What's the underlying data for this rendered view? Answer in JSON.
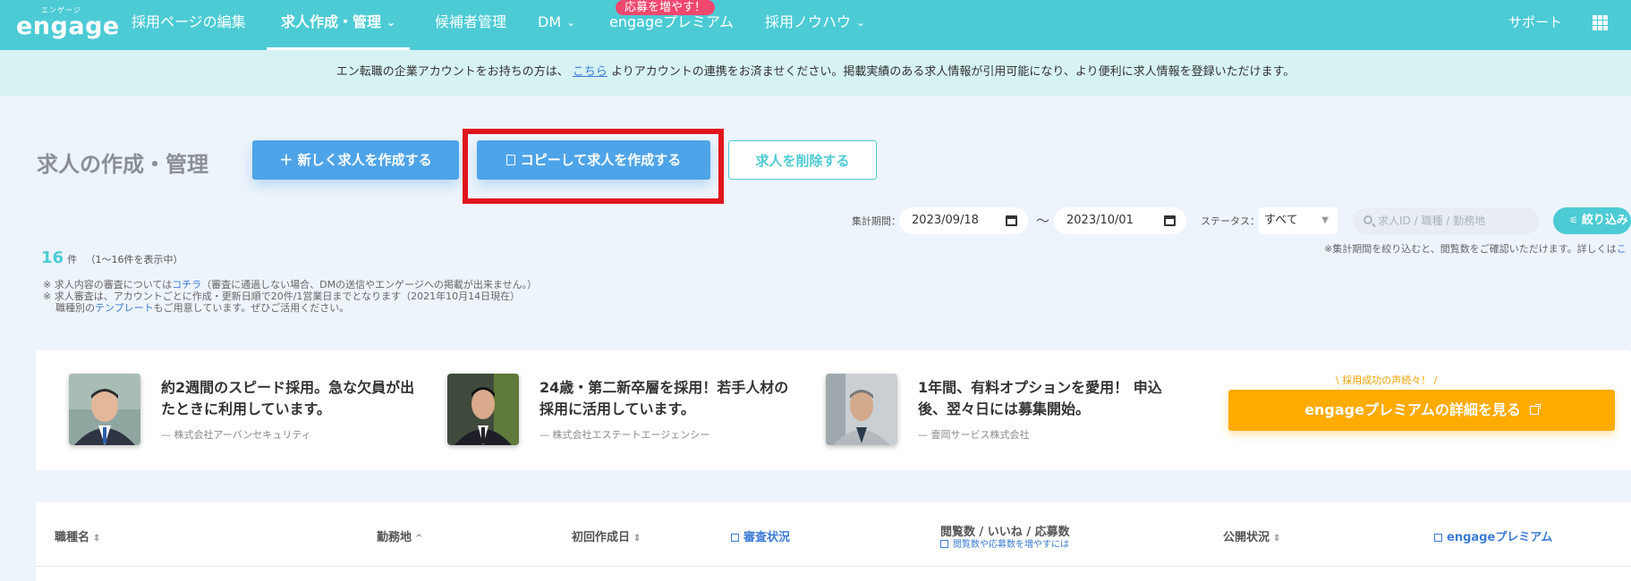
{
  "header": {
    "logo_small": "エンゲージ",
    "logo": "engage",
    "nav": [
      {
        "label": "採用ページの編集"
      },
      {
        "label": "求人作成・管理"
      },
      {
        "label": "候補者管理"
      },
      {
        "label": "DM"
      },
      {
        "label": "engageプレミアム"
      },
      {
        "label": "採用ノウハウ"
      }
    ],
    "promo_badge": "応募を増やす！",
    "support": "サポート"
  },
  "notice": {
    "before": "エン転職の企業アカウントをお持ちの方は、",
    "link": "こちら",
    "after": "よりアカウントの連携をお済ませください。掲載実績のある求人情報が引用可能になり、より便利に求人情報を登録いただけます。"
  },
  "main": {
    "title": "求人の作成・管理",
    "new_job_button": "＋ 新しく求人を作成する",
    "copy_job_button": "コピーして求人を作成する",
    "delete_job_button": "求人を削除する"
  },
  "filters": {
    "period_label": "集計期間：",
    "start_date": "2023/09/18",
    "separator": "～",
    "end_date": "2023/10/01",
    "status_label": "ステータス：",
    "status_value": "すべて",
    "search_placeholder": "求人ID / 職種 / 勤務地",
    "filter_button": "絞り込み",
    "hint": "※集計期間を絞り込むと、閲覧数をご確認いただけます。詳しくは",
    "hint_link": "こ"
  },
  "results": {
    "count": "16",
    "count_unit": "件",
    "range": "（1～16件を表示中）"
  },
  "notes": {
    "line1_a": "※ 求人内容の審査については",
    "line1_link": "コチラ",
    "line1_b": "（審査に通過しない場合、DMの送信やエンゲージへの掲載が出来ません。）",
    "line2": "※ 求人審査は、アカウントごとに作成・更新日順で20件/1営業日までとなります（2021年10月14日現在）",
    "line3_a": "職種別の",
    "line3_link": "テンプレート",
    "line3_b": "もご用意しています。ぜひご活用ください。"
  },
  "testimonials": [
    {
      "quote": "約2週間のスピード採用。急な欠員が出たときに利用しています。",
      "company": "— 株式会社アーバンセキュリティ"
    },
    {
      "quote": "24歳・第二新卒層を採用！若手人材の採用に活用しています。",
      "company": "— 株式会社エステートエージェンシー"
    },
    {
      "quote": "1年間、有料オプションを愛用！ 申込後、翌々日には募集開始。",
      "company": "— 壹岡サービス株式会社"
    }
  ],
  "premium": {
    "label": "\\ 採用成功の声続々！ /",
    "button": "engageプレミアムの詳細を見る"
  },
  "table": {
    "columns": [
      {
        "label": "職種名"
      },
      {
        "label": "勤務地"
      },
      {
        "label": "初回作成日"
      },
      {
        "label": "審査状況"
      },
      {
        "label": "閲覧数 / いいね / 応募数",
        "sub": "閲覧数や応募数を増やすには"
      },
      {
        "label": "公開状況"
      },
      {
        "label": "engageプレミアム"
      }
    ]
  },
  "colors": {
    "brand": "#4ccbd5",
    "primary": "#4ea4e8",
    "accent": "#ffab00",
    "highlight": "#e0141c"
  }
}
